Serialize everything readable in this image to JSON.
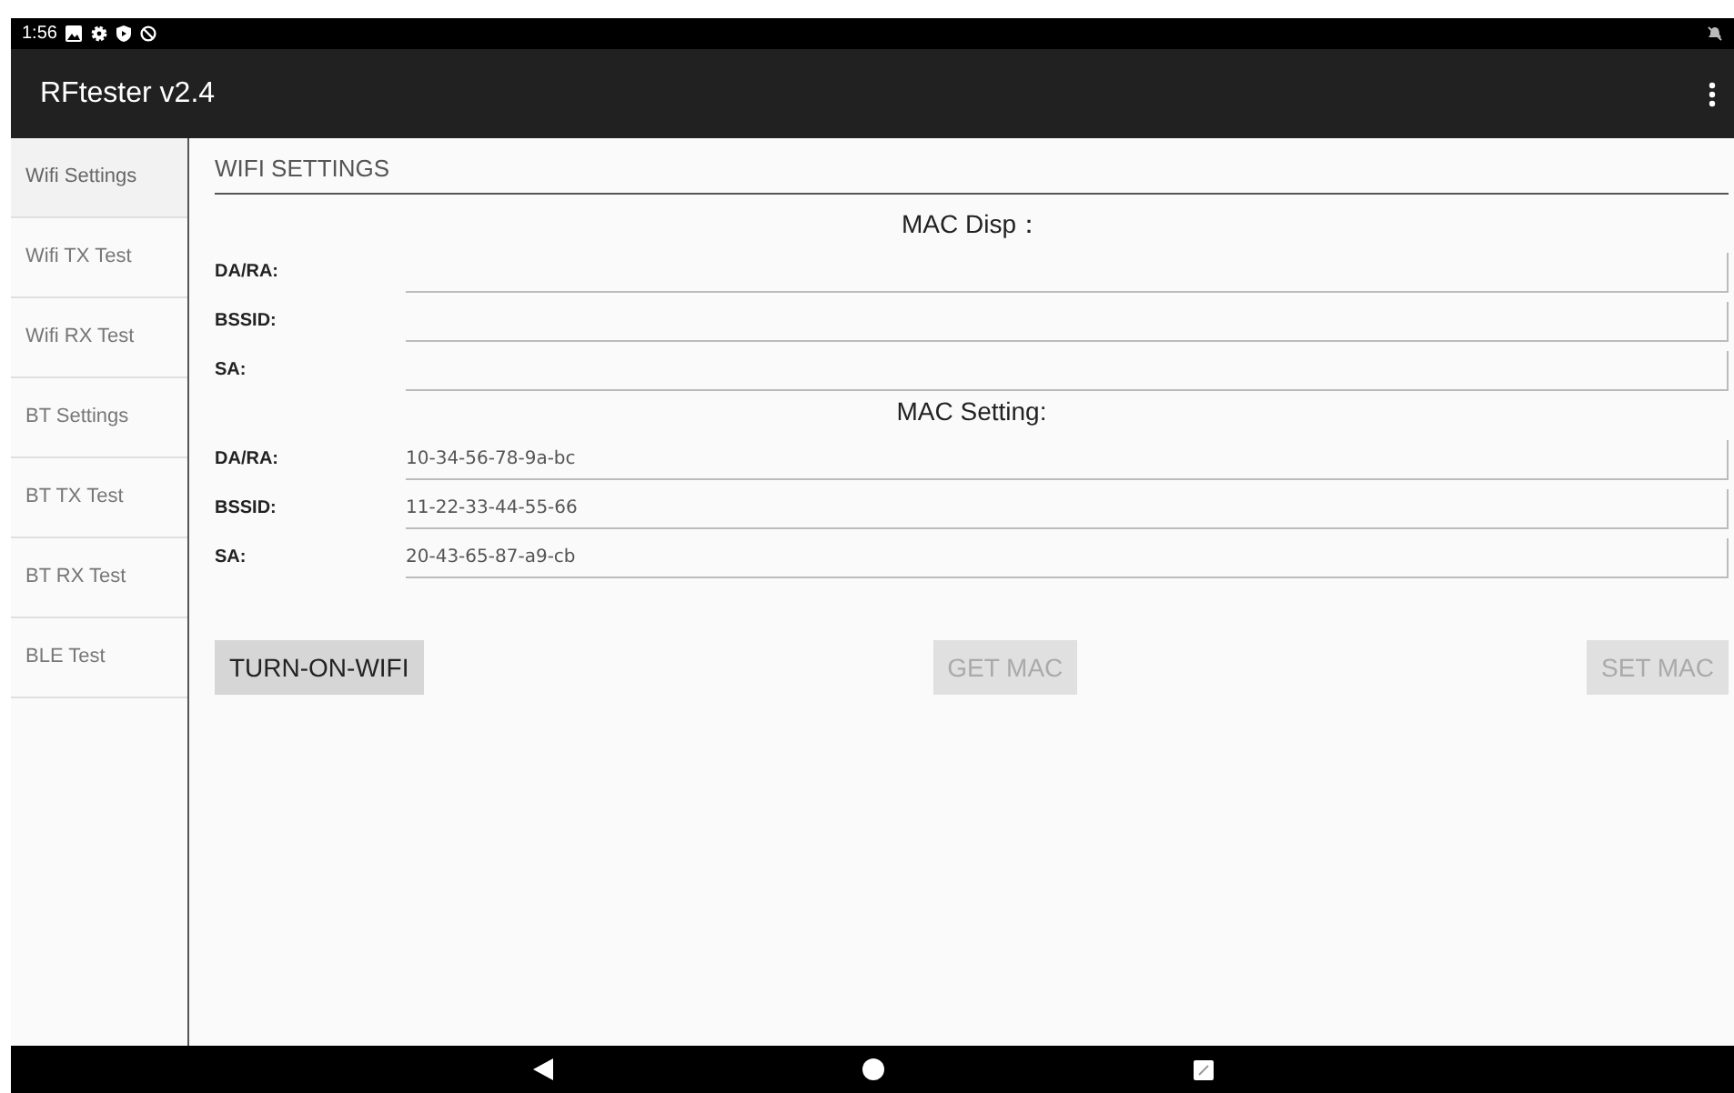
{
  "status_bar": {
    "time": "1:56"
  },
  "app_bar": {
    "title": "RFtester v2.4"
  },
  "sidebar": {
    "items": [
      {
        "label": "Wifi Settings",
        "selected": true
      },
      {
        "label": "Wifi TX Test",
        "selected": false
      },
      {
        "label": "Wifi RX Test",
        "selected": false
      },
      {
        "label": "BT Settings",
        "selected": false
      },
      {
        "label": "BT TX Test",
        "selected": false
      },
      {
        "label": "BT RX Test",
        "selected": false
      },
      {
        "label": "BLE Test",
        "selected": false
      }
    ]
  },
  "section_title": "WIFI SETTINGS",
  "groups": [
    {
      "heading": "MAC Disp：",
      "fields": [
        {
          "label": "DA/RA:"
        },
        {
          "label": "BSSID:"
        },
        {
          "label": "SA:"
        }
      ]
    },
    {
      "heading": "MAC Setting:",
      "fields": [
        {
          "label": "DA/RA:",
          "value": "10-34-56-78-9a-bc"
        },
        {
          "label": "BSSID:",
          "value": "11-22-33-44-55-66"
        },
        {
          "label": "SA:",
          "value": "20-43-65-87-a9-cb"
        }
      ]
    }
  ],
  "buttons": [
    {
      "label": "TURN-ON-WIFI",
      "disabled": false
    },
    {
      "label": "GET MAC",
      "disabled": true
    },
    {
      "label": "SET MAC",
      "disabled": true
    }
  ]
}
